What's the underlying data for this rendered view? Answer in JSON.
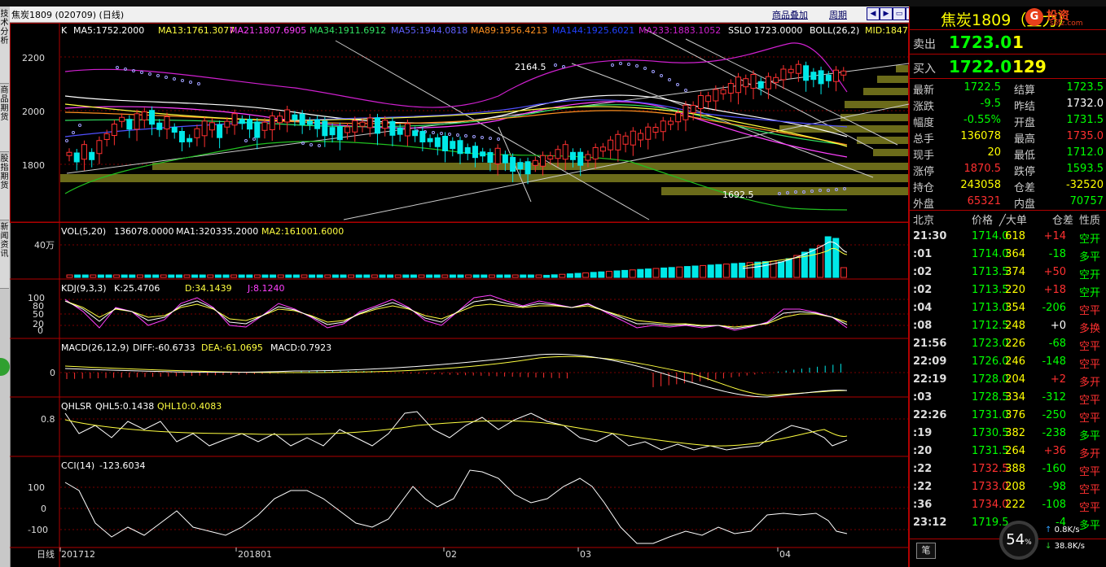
{
  "window": {
    "title": "焦炭1809 (020709) (日线)"
  },
  "toolbar": {
    "overlay_label": "商品叠加",
    "period_label": "周期"
  },
  "sidebar": {
    "tabs": [
      "技术分析",
      "商品期货",
      "股指期货",
      "新闻资讯"
    ]
  },
  "main_indicator": {
    "k_label": "K",
    "ma5": "MA5:1752.2000",
    "ma13": "MA13:1761.3077",
    "ma21": "MA21:1807.6905",
    "ma34": "MA34:1911.6912",
    "ma55": "MA55:1944.0818",
    "ma89": "MA89:1956.4213",
    "ma144": "MA144:1925.6021",
    "ma233": "MA233:1883.1052",
    "sslo": "SSLO  1723.0000",
    "boll": "BOLL(26,2)",
    "mid": "MID:1847",
    "y_ticks": [
      "2200",
      "2000",
      "1800"
    ],
    "high_mark": "2164.5",
    "low_mark": "1692.5"
  },
  "vol_indicator": {
    "label": "VOL(5,20)",
    "value": "136078.0000",
    "ma1": "MA1:320335.2000",
    "ma2": "MA2:161001.6000",
    "y_tick": "40万"
  },
  "kdj_indicator": {
    "label": "KDJ(9,3,3)",
    "k": "K:25.4706",
    "d": "D:34.1439",
    "j": "J:8.1240",
    "y_ticks": [
      "100",
      "80",
      "50",
      "20",
      "0"
    ]
  },
  "macd_indicator": {
    "label": "MACD(26,12,9)",
    "diff": "DIFF:-60.6733",
    "dea": "DEA:-61.0695",
    "macd": "MACD:0.7923",
    "y_tick": "0"
  },
  "qhlsr_indicator": {
    "label": "QHLSR",
    "qhl5": "QHL5:0.1438",
    "qhl10": "QHL10:0.4083",
    "y_tick": "0.8"
  },
  "cci_indicator": {
    "label": "CCI(14)",
    "value": "-123.6034",
    "y_ticks": [
      "100",
      "0",
      "-100"
    ]
  },
  "x_axis": {
    "period": "日线",
    "labels": [
      "201712",
      "201801",
      "02",
      "03",
      "04"
    ]
  },
  "quote_panel": {
    "name": "焦炭1809（主力）",
    "logo_text": "投资",
    "logo_sub": "setz.com",
    "sell_label": "卖出",
    "sell_price": "1723.0",
    "sell_vol": "1",
    "buy_label": "买入",
    "buy_price": "1722.0",
    "buy_vol": "129",
    "stats": [
      {
        "l1": "最新",
        "v1": "1722.5",
        "c1": "#00ff00",
        "l2": "结算",
        "v2": "1723.5",
        "c2": "#00ff00"
      },
      {
        "l1": "涨跌",
        "v1": "-9.5",
        "c1": "#00ff00",
        "l2": "昨结",
        "v2": "1732.0",
        "c2": "#ffffff"
      },
      {
        "l1": "幅度",
        "v1": "-0.55%",
        "c1": "#00ff00",
        "l2": "开盘",
        "v2": "1731.5",
        "c2": "#00ff00"
      },
      {
        "l1": "总手",
        "v1": "136078",
        "c1": "#ffff00",
        "l2": "最高",
        "v2": "1735.0",
        "c2": "#ff3030"
      },
      {
        "l1": "现手",
        "v1": "20",
        "c1": "#ffff00",
        "l2": "最低",
        "v2": "1712.0",
        "c2": "#00ff00"
      },
      {
        "l1": "涨停",
        "v1": "1870.5",
        "c1": "#ff3030",
        "l2": "跌停",
        "v2": "1593.5",
        "c2": "#00ff00"
      },
      {
        "l1": "持仓",
        "v1": "243058",
        "c1": "#ffff00",
        "l2": "仓差",
        "v2": "-32520",
        "c2": "#ffff00"
      },
      {
        "l1": "外盘",
        "v1": "65321",
        "c1": "#ff3030",
        "l2": "内盘",
        "v2": "70757",
        "c2": "#00ff00"
      }
    ],
    "tick_header": [
      "北京",
      "价格",
      "╱大单",
      "仓差",
      "性质"
    ],
    "ticks": [
      {
        "time": "21:30",
        "price": "1714.0",
        "pc": "#00ff00",
        "vol": "618",
        "diff": "+14",
        "dc": "#ff3030",
        "nature": "空开",
        "nc": "#00ff00"
      },
      {
        "time": ":01",
        "price": "1714.0",
        "pc": "#00ff00",
        "vol": "364",
        "diff": "-18",
        "dc": "#00ff00",
        "nature": "多平",
        "nc": "#00ff00"
      },
      {
        "time": ":02",
        "price": "1713.5",
        "pc": "#00ff00",
        "vol": "374",
        "diff": "+50",
        "dc": "#ff3030",
        "nature": "空开",
        "nc": "#00ff00"
      },
      {
        "time": ":02",
        "price": "1713.5",
        "pc": "#00ff00",
        "vol": "220",
        "diff": "+18",
        "dc": "#ff3030",
        "nature": "空开",
        "nc": "#00ff00"
      },
      {
        "time": ":04",
        "price": "1713.0",
        "pc": "#00ff00",
        "vol": "354",
        "diff": "-206",
        "dc": "#00ff00",
        "nature": "空平",
        "nc": "#ff3030"
      },
      {
        "time": ":08",
        "price": "1712.5",
        "pc": "#00ff00",
        "vol": "248",
        "diff": "+0",
        "dc": "#ffffff",
        "nature": "多换",
        "nc": "#ff3030"
      },
      {
        "time": "21:56",
        "price": "1723.0",
        "pc": "#00ff00",
        "vol": "226",
        "diff": "-68",
        "dc": "#00ff00",
        "nature": "空平",
        "nc": "#ff3030"
      },
      {
        "time": "22:09",
        "price": "1726.0",
        "pc": "#00ff00",
        "vol": "246",
        "diff": "-148",
        "dc": "#00ff00",
        "nature": "空平",
        "nc": "#ff3030"
      },
      {
        "time": "22:19",
        "price": "1728.0",
        "pc": "#00ff00",
        "vol": "204",
        "diff": "+2",
        "dc": "#ff3030",
        "nature": "多开",
        "nc": "#ff3030"
      },
      {
        "time": ":03",
        "price": "1728.5",
        "pc": "#00ff00",
        "vol": "334",
        "diff": "-312",
        "dc": "#00ff00",
        "nature": "空平",
        "nc": "#ff3030"
      },
      {
        "time": "22:26",
        "price": "1731.0",
        "pc": "#00ff00",
        "vol": "376",
        "diff": "-250",
        "dc": "#00ff00",
        "nature": "空平",
        "nc": "#ff3030"
      },
      {
        "time": ":19",
        "price": "1730.5",
        "pc": "#00ff00",
        "vol": "382",
        "diff": "-238",
        "dc": "#00ff00",
        "nature": "多平",
        "nc": "#00ff00"
      },
      {
        "time": ":20",
        "price": "1731.5",
        "pc": "#00ff00",
        "vol": "264",
        "diff": "+36",
        "dc": "#ff3030",
        "nature": "多开",
        "nc": "#ff3030"
      },
      {
        "time": ":22",
        "price": "1732.5",
        "pc": "#ff3030",
        "vol": "388",
        "diff": "-160",
        "dc": "#00ff00",
        "nature": "空平",
        "nc": "#ff3030"
      },
      {
        "time": ":22",
        "price": "1733.0",
        "pc": "#ff3030",
        "vol": "208",
        "diff": "-98",
        "dc": "#00ff00",
        "nature": "空平",
        "nc": "#ff3030"
      },
      {
        "time": ":36",
        "price": "1734.0",
        "pc": "#ff3030",
        "vol": "222",
        "diff": "-108",
        "dc": "#00ff00",
        "nature": "空平",
        "nc": "#ff3030"
      },
      {
        "time": "23:12",
        "price": "1719.5",
        "pc": "#00ff00",
        "vol": "",
        "diff": "-4",
        "dc": "#00ff00",
        "nature": "多平",
        "nc": "#00ff00"
      }
    ],
    "tab_label": "笔",
    "percent": "54",
    "up_speed": "0.8K/s",
    "down_speed": "38.8K/s"
  }
}
